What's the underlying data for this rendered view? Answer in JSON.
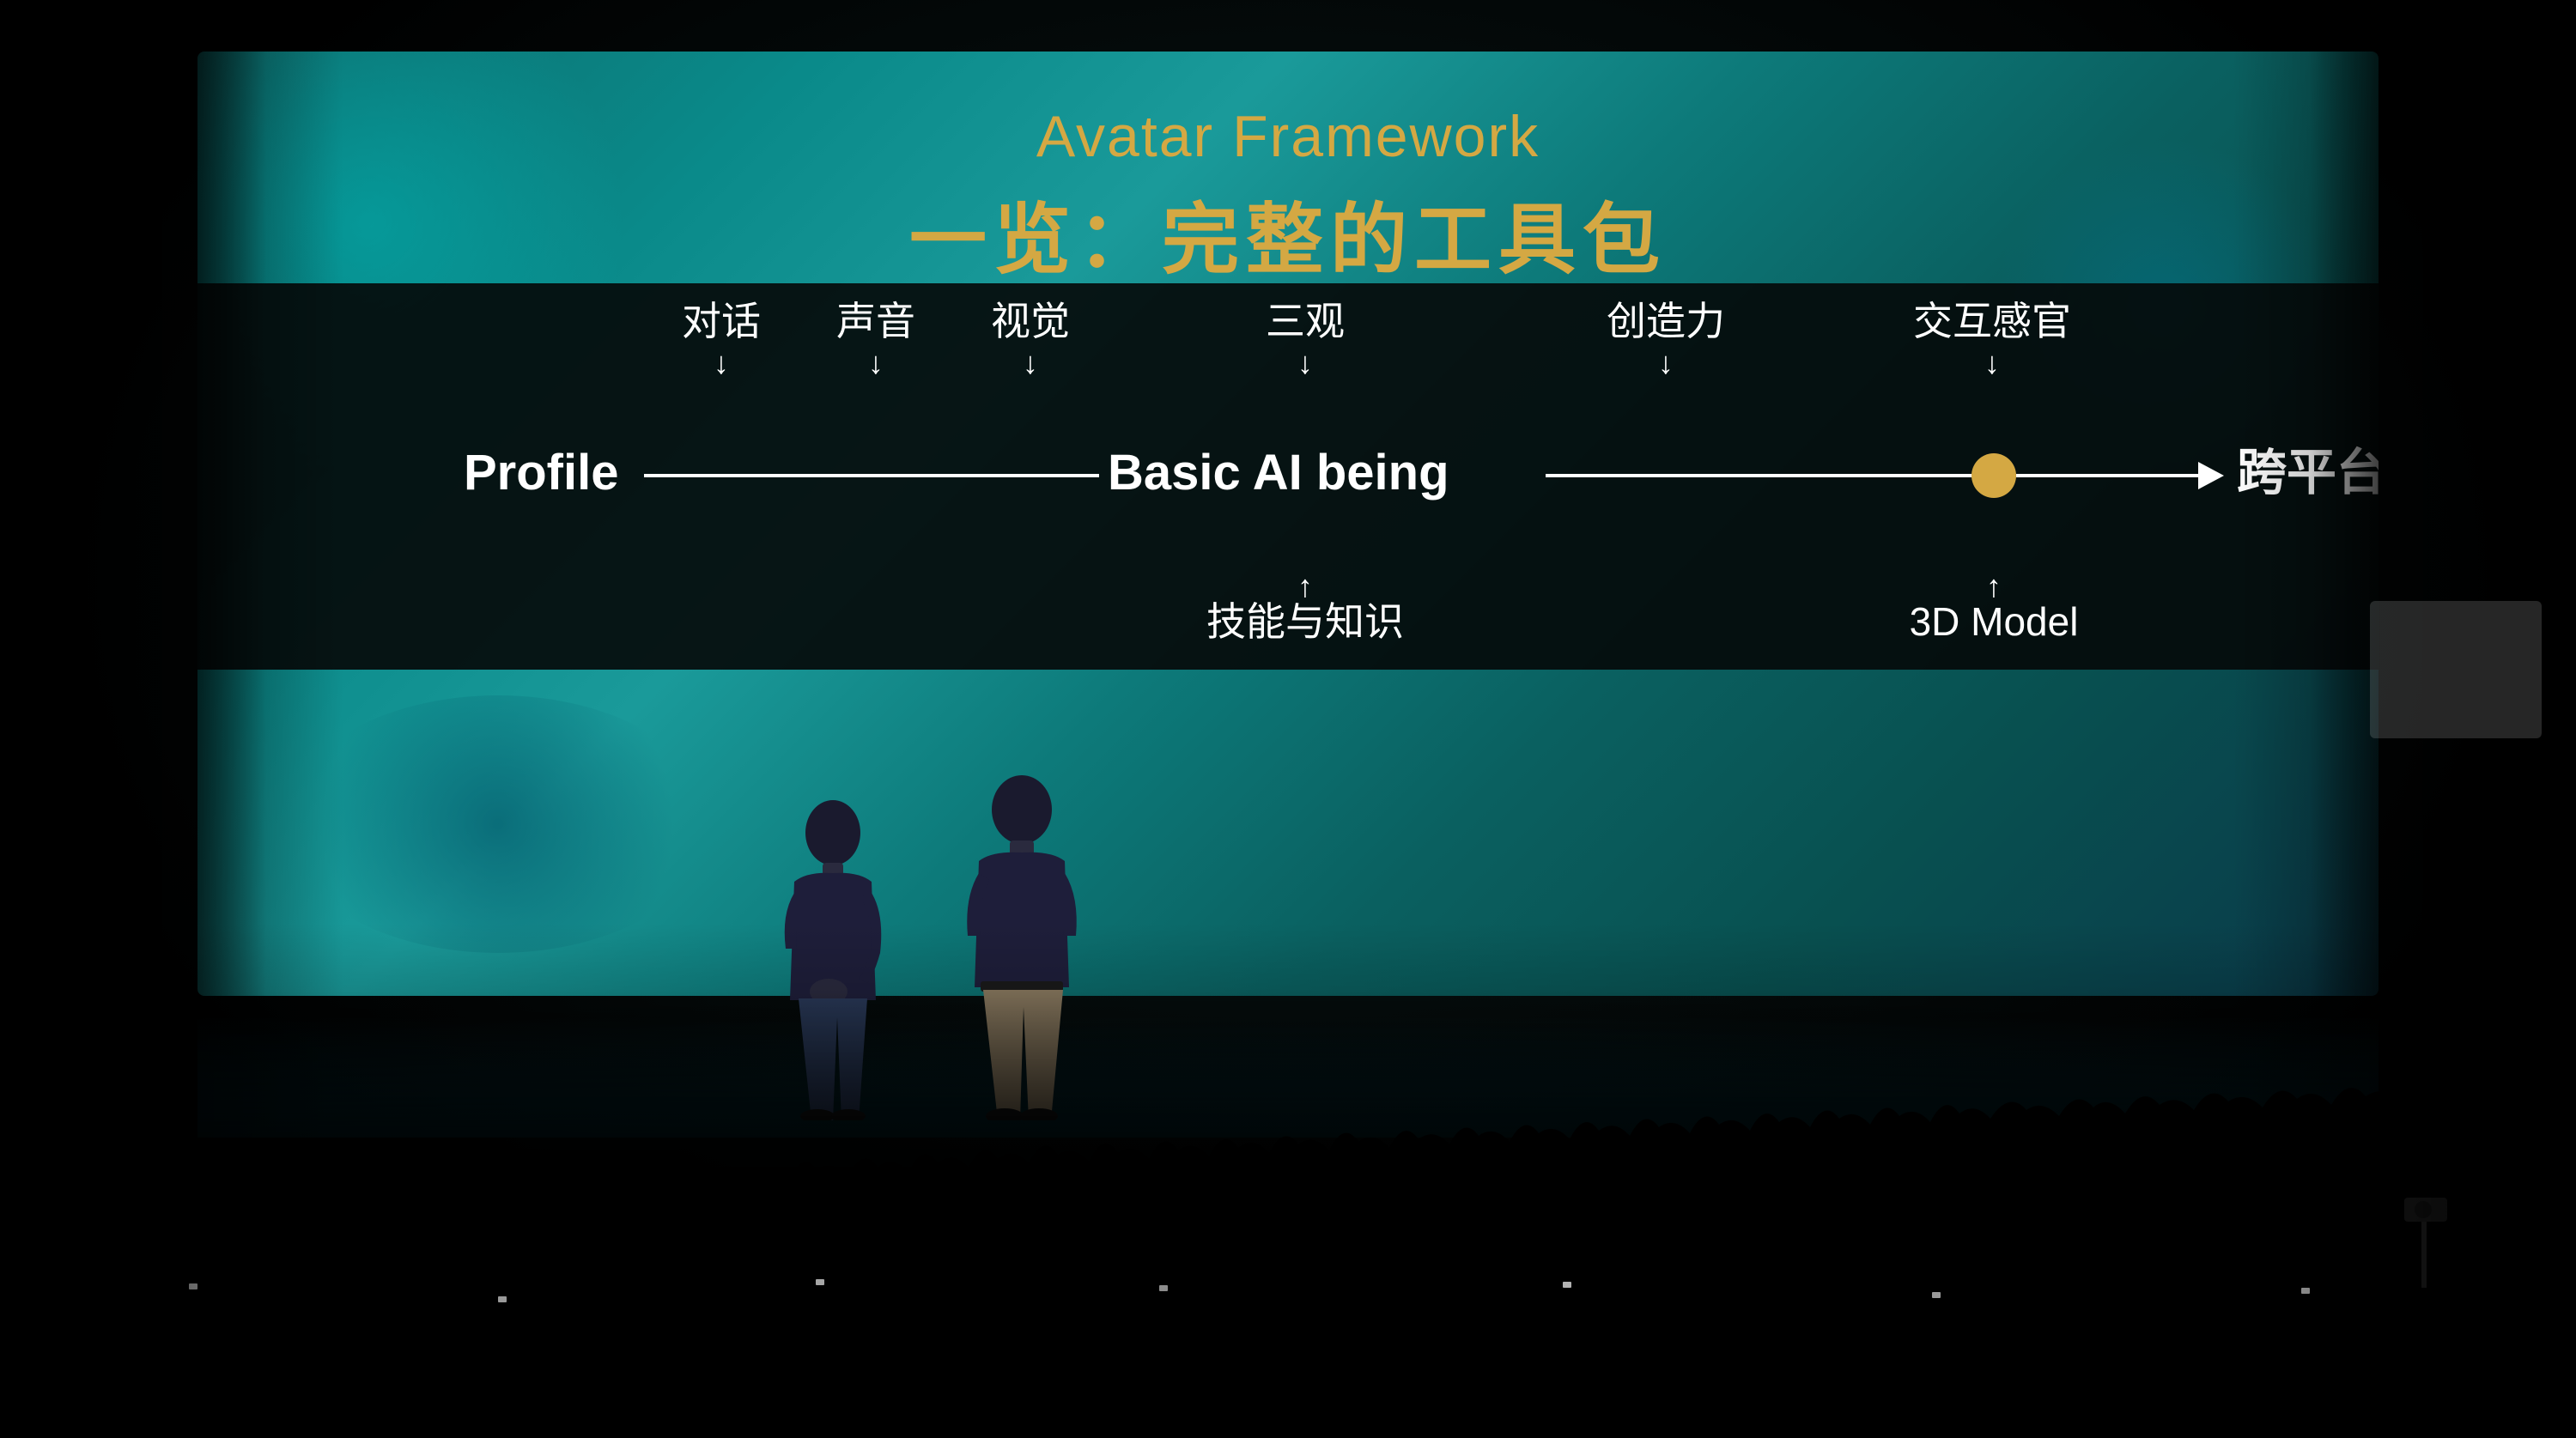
{
  "slide": {
    "title_en": "Avatar Framework",
    "title_zh": "一览：完整的工具包",
    "colors": {
      "background_teal": "#0a8080",
      "title_gold": "#d4a843",
      "diagram_bg": "#050a0a",
      "text_white": "#ffffff",
      "dot_gold": "#d4a843"
    },
    "diagram": {
      "top_labels": [
        {
          "text": "对话",
          "position": 1
        },
        {
          "text": "声音",
          "position": 2
        },
        {
          "text": "视觉",
          "position": 3
        },
        {
          "text": "三观",
          "position": 4
        },
        {
          "text": "创造力",
          "position": 5
        },
        {
          "text": "交互感官",
          "position": 6
        }
      ],
      "node_left": "Profile",
      "node_center": "Basic AI being",
      "node_right": "跨平台部署",
      "bottom_labels": [
        {
          "text": "技能与知识",
          "position": 1
        },
        {
          "text": "3D Model",
          "position": 2
        }
      ]
    }
  }
}
